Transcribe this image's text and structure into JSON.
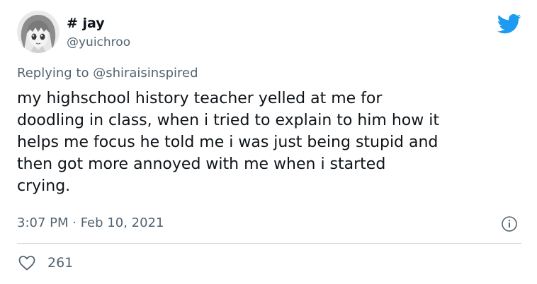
{
  "author": {
    "display_name": "# jay",
    "handle": "@yuichroo",
    "avatar_icon": "anime-avatar"
  },
  "reply": {
    "prefix": "Replying to ",
    "mention": "@shiraisinspired"
  },
  "tweet": {
    "text": "my highschool history teacher yelled at me for\ndoodling in class, when i tried to explain to him how it\nhelps me focus he told me i was just being stupid and\nthen got more annoyed with me when i started\ncrying."
  },
  "meta": {
    "timestamp": "3:07 PM · Feb 10, 2021",
    "info_icon": "info-icon"
  },
  "stats": {
    "like_icon": "heart-icon",
    "likes": "261"
  },
  "brand": {
    "logo_icon": "twitter-bird-icon",
    "accent": "#1d9bf0"
  }
}
